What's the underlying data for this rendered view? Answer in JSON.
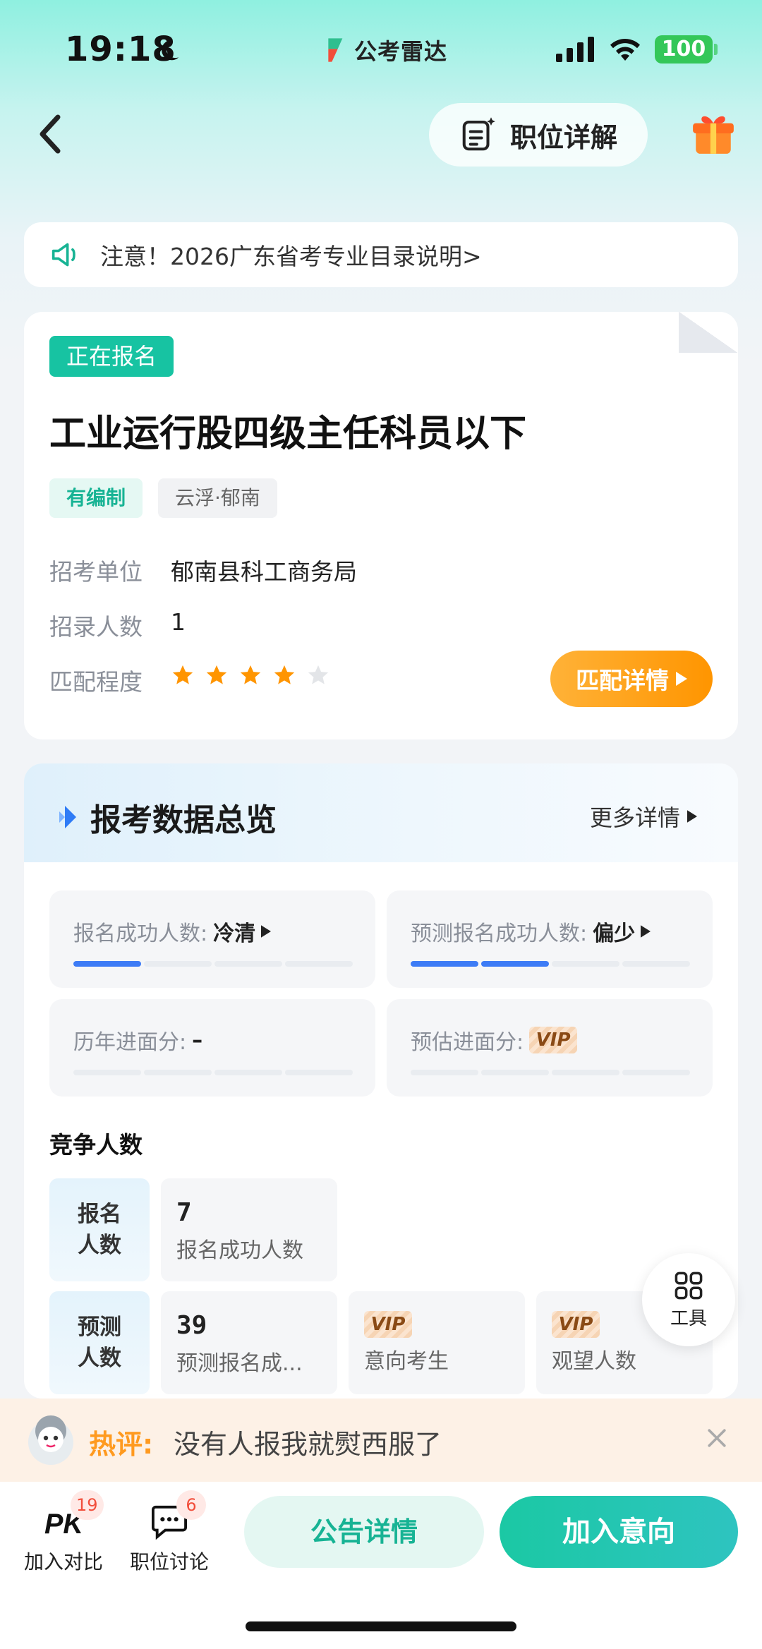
{
  "status_bar": {
    "time": "19:18",
    "battery": "100",
    "app_brand": "公考雷达"
  },
  "nav": {
    "detail_label": "职位详解"
  },
  "notice": {
    "text": "注意！2026广东省考专业目录说明>"
  },
  "job": {
    "status_badge": "正在报名",
    "title": "工业运行股四级主任科员以下",
    "tags": [
      "有编制",
      "云浮·郁南"
    ],
    "rows": [
      {
        "label": "招考单位",
        "value": "郁南县科工商务局"
      },
      {
        "label": "招录人数",
        "value": "1"
      },
      {
        "label": "匹配程度",
        "value": ""
      }
    ],
    "match_stars": {
      "filled": 4,
      "total": 5
    },
    "match_button": "匹配详情"
  },
  "overview": {
    "title": "报考数据总览",
    "more": "更多详情",
    "stats": [
      {
        "label": "报名成功人数:",
        "value": "冷清",
        "level": 1,
        "segments": 4
      },
      {
        "label": "预测报名成功人数:",
        "value": "偏少",
        "level": 2,
        "segments": 4
      },
      {
        "label": "历年进面分:",
        "value": "–",
        "level": 0,
        "segments": 4
      },
      {
        "label": "预估进面分:",
        "value": "VIP",
        "level": 0,
        "segments": 4
      }
    ],
    "competition_title": "竞争人数",
    "rows": [
      {
        "label": "报名人数",
        "cells": [
          {
            "number": "7",
            "desc": "报名成功人数"
          }
        ]
      },
      {
        "label": "预测人数",
        "cells": [
          {
            "number": "39",
            "desc": "预测报名成..."
          },
          {
            "vip": "VIP",
            "desc": "意向考生"
          },
          {
            "vip": "VIP",
            "desc": "观望人数"
          }
        ]
      }
    ]
  },
  "tool": {
    "label": "工具"
  },
  "hot_comment": {
    "label": "热评:",
    "text": "没有人报我就熨西服了"
  },
  "bottom": {
    "compare": {
      "label": "加入对比",
      "badge": "19"
    },
    "discuss": {
      "label": "职位讨论",
      "badge": "6"
    },
    "notice_button": "公告详情",
    "join_button": "加入意向"
  },
  "colors": {
    "accent": "#17c3a2",
    "orange": "#ff9500",
    "blue": "#3d7cf6"
  }
}
